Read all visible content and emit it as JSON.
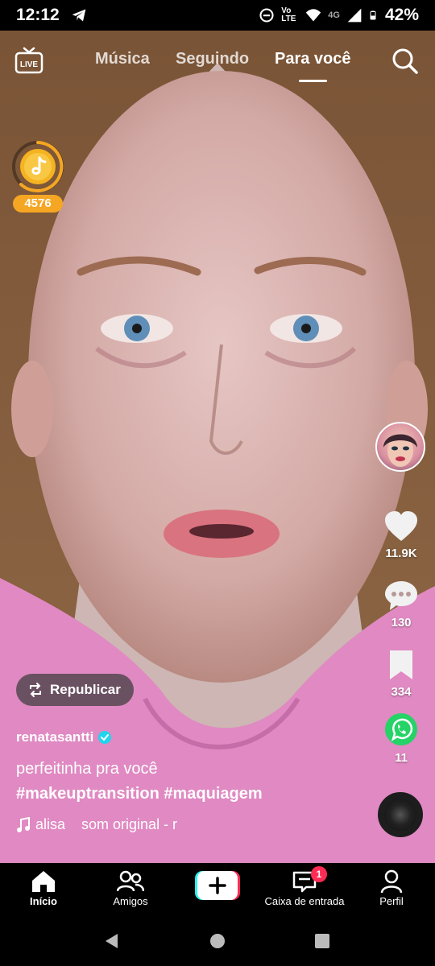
{
  "status_bar": {
    "time": "12:12",
    "network": "Vo LTE",
    "network_type": "4G",
    "battery": "42%"
  },
  "top_nav": {
    "live_label": "LIVE",
    "tabs": [
      {
        "label": "Música"
      },
      {
        "label": "Seguindo"
      },
      {
        "label": "Para você",
        "active": true
      }
    ]
  },
  "coins": {
    "count": "4576"
  },
  "actions": {
    "likes": "11.9K",
    "comments": "130",
    "saves": "334",
    "shares": "11"
  },
  "post": {
    "republish_label": "Republicar",
    "username": "renatasantti",
    "caption": "perfeitinha pra você",
    "hashtags": "#makeuptransition #maquiagem",
    "music": "alisa    som original - r"
  },
  "bottom_nav": {
    "items": [
      {
        "label": "Início",
        "active": true
      },
      {
        "label": "Amigos"
      },
      {
        "label": "Caixa de entrada",
        "badge": "1"
      },
      {
        "label": "Perfil"
      }
    ]
  },
  "colors": {
    "accent": "#fe2c55",
    "teal": "#25f4ee",
    "coin": "#f5a623",
    "whatsapp": "#25d366",
    "verified": "#20d5ec"
  }
}
